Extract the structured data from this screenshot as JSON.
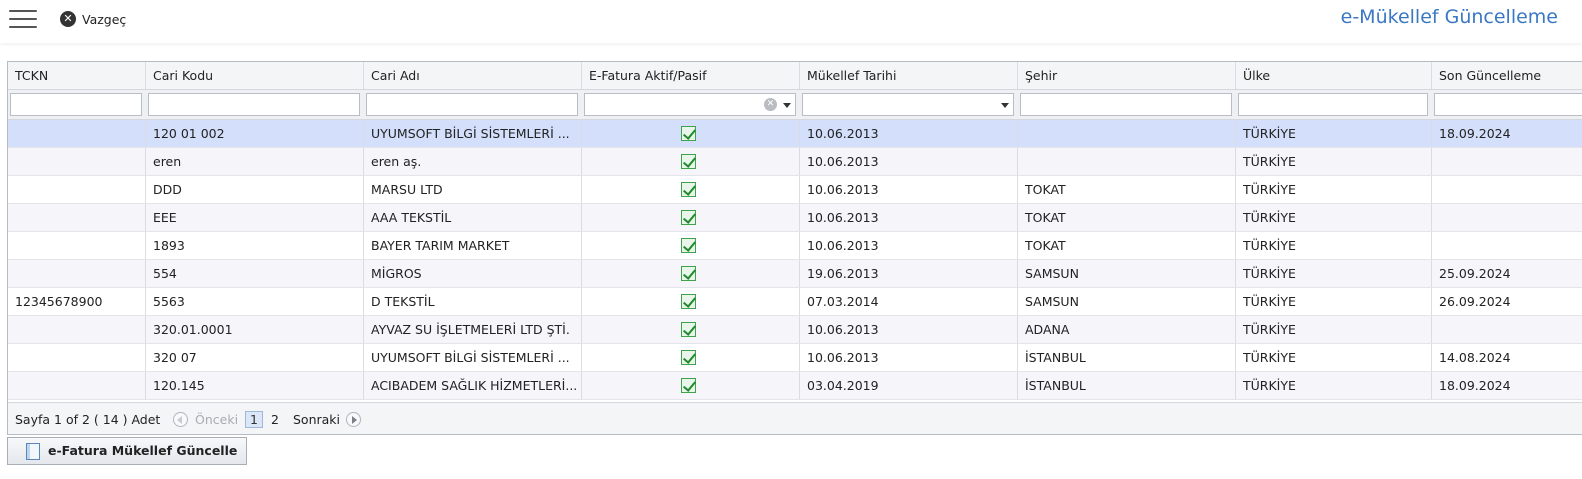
{
  "toolbar": {
    "menu_icon": "hamburger-icon",
    "cancel_icon": "close-circle-icon",
    "cancel_label": "Vazgeç"
  },
  "page_title": "e-Mükellef Güncelleme",
  "accent_color": "#3a78c4",
  "table": {
    "columns": [
      "TCKN",
      "Cari Kodu",
      "Cari Adı",
      "E-Fatura Aktif/Pasif",
      "Mükellef Tarihi",
      "Şehir",
      "Ülke",
      "Son Güncelleme"
    ],
    "rows": [
      {
        "tckn": "",
        "code": "120 01 002",
        "name": "UYUMSOFT BİLGİ SİSTEMLERİ ...",
        "active": true,
        "date": "10.06.2013",
        "city": "",
        "country": "TÜRKİYE",
        "updated": "18.09.2024",
        "selected": true
      },
      {
        "tckn": "",
        "code": "eren",
        "name": "eren aş.",
        "active": true,
        "date": "10.06.2013",
        "city": "",
        "country": "TÜRKİYE",
        "updated": ""
      },
      {
        "tckn": "",
        "code": "DDD",
        "name": "MARSU LTD",
        "active": true,
        "date": "10.06.2013",
        "city": "TOKAT",
        "country": "TÜRKİYE",
        "updated": ""
      },
      {
        "tckn": "",
        "code": "EEE",
        "name": "AAA TEKSTİL",
        "active": true,
        "date": "10.06.2013",
        "city": "TOKAT",
        "country": "TÜRKİYE",
        "updated": ""
      },
      {
        "tckn": "",
        "code": "1893",
        "name": "BAYER TARIM MARKET",
        "active": true,
        "date": "10.06.2013",
        "city": "TOKAT",
        "country": "TÜRKİYE",
        "updated": ""
      },
      {
        "tckn": "",
        "code": "554",
        "name": "MİGROS",
        "active": true,
        "date": "19.06.2013",
        "city": "SAMSUN",
        "country": "TÜRKİYE",
        "updated": "25.09.2024"
      },
      {
        "tckn": "12345678900",
        "code": "5563",
        "name": "D TEKSTİL",
        "active": true,
        "date": "07.03.2014",
        "city": "SAMSUN",
        "country": "TÜRKİYE",
        "updated": "26.09.2024"
      },
      {
        "tckn": "",
        "code": "320.01.0001",
        "name": "AYVAZ SU İŞLETMELERİ LTD ŞTİ.",
        "active": true,
        "date": "10.06.2013",
        "city": "ADANA",
        "country": "TÜRKİYE",
        "updated": ""
      },
      {
        "tckn": "",
        "code": "320 07",
        "name": "UYUMSOFT BİLGİ SİSTEMLERİ ...",
        "active": true,
        "date": "10.06.2013",
        "city": "İSTANBUL",
        "country": "TÜRKİYE",
        "updated": "14.08.2024"
      },
      {
        "tckn": "",
        "code": "120.145",
        "name": "ACIBADEM SAĞLIK HİZMETLERİ...",
        "active": true,
        "date": "03.04.2019",
        "city": "İSTANBUL",
        "country": "TÜRKİYE",
        "updated": "18.09.2024"
      }
    ]
  },
  "pager": {
    "summary": "Sayfa 1 of 2 ( 14 ) Adet",
    "prev_label": "Önceki",
    "page1": "1",
    "page2": "2",
    "next_label": "Sonraki"
  },
  "footer": {
    "update_button_label": "e-Fatura Mükellef Güncelle",
    "update_button_icon": "document-icon"
  }
}
